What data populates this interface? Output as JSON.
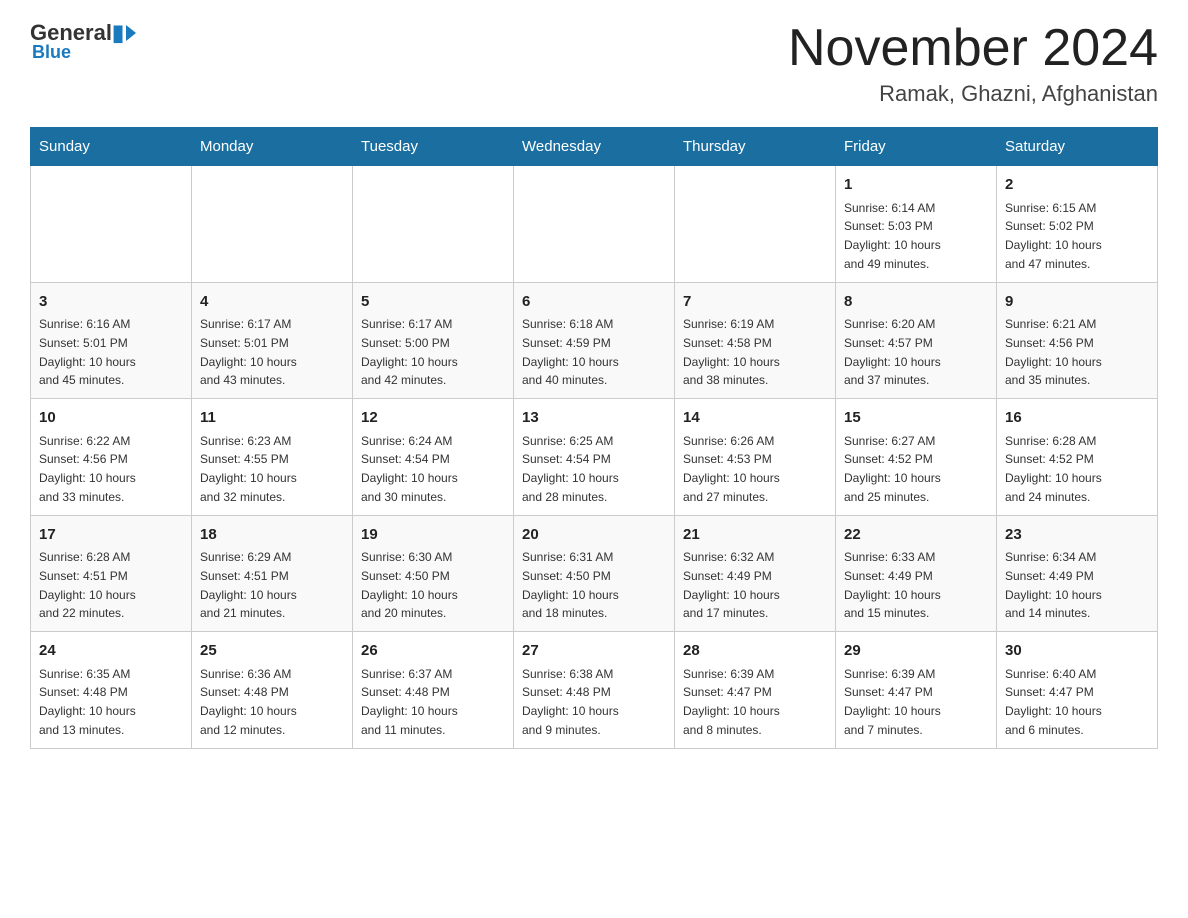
{
  "logo": {
    "general": "General",
    "blue": "Blue"
  },
  "header": {
    "month": "November 2024",
    "location": "Ramak, Ghazni, Afghanistan"
  },
  "weekdays": [
    "Sunday",
    "Monday",
    "Tuesday",
    "Wednesday",
    "Thursday",
    "Friday",
    "Saturday"
  ],
  "weeks": [
    [
      {
        "day": "",
        "info": ""
      },
      {
        "day": "",
        "info": ""
      },
      {
        "day": "",
        "info": ""
      },
      {
        "day": "",
        "info": ""
      },
      {
        "day": "",
        "info": ""
      },
      {
        "day": "1",
        "info": "Sunrise: 6:14 AM\nSunset: 5:03 PM\nDaylight: 10 hours\nand 49 minutes."
      },
      {
        "day": "2",
        "info": "Sunrise: 6:15 AM\nSunset: 5:02 PM\nDaylight: 10 hours\nand 47 minutes."
      }
    ],
    [
      {
        "day": "3",
        "info": "Sunrise: 6:16 AM\nSunset: 5:01 PM\nDaylight: 10 hours\nand 45 minutes."
      },
      {
        "day": "4",
        "info": "Sunrise: 6:17 AM\nSunset: 5:01 PM\nDaylight: 10 hours\nand 43 minutes."
      },
      {
        "day": "5",
        "info": "Sunrise: 6:17 AM\nSunset: 5:00 PM\nDaylight: 10 hours\nand 42 minutes."
      },
      {
        "day": "6",
        "info": "Sunrise: 6:18 AM\nSunset: 4:59 PM\nDaylight: 10 hours\nand 40 minutes."
      },
      {
        "day": "7",
        "info": "Sunrise: 6:19 AM\nSunset: 4:58 PM\nDaylight: 10 hours\nand 38 minutes."
      },
      {
        "day": "8",
        "info": "Sunrise: 6:20 AM\nSunset: 4:57 PM\nDaylight: 10 hours\nand 37 minutes."
      },
      {
        "day": "9",
        "info": "Sunrise: 6:21 AM\nSunset: 4:56 PM\nDaylight: 10 hours\nand 35 minutes."
      }
    ],
    [
      {
        "day": "10",
        "info": "Sunrise: 6:22 AM\nSunset: 4:56 PM\nDaylight: 10 hours\nand 33 minutes."
      },
      {
        "day": "11",
        "info": "Sunrise: 6:23 AM\nSunset: 4:55 PM\nDaylight: 10 hours\nand 32 minutes."
      },
      {
        "day": "12",
        "info": "Sunrise: 6:24 AM\nSunset: 4:54 PM\nDaylight: 10 hours\nand 30 minutes."
      },
      {
        "day": "13",
        "info": "Sunrise: 6:25 AM\nSunset: 4:54 PM\nDaylight: 10 hours\nand 28 minutes."
      },
      {
        "day": "14",
        "info": "Sunrise: 6:26 AM\nSunset: 4:53 PM\nDaylight: 10 hours\nand 27 minutes."
      },
      {
        "day": "15",
        "info": "Sunrise: 6:27 AM\nSunset: 4:52 PM\nDaylight: 10 hours\nand 25 minutes."
      },
      {
        "day": "16",
        "info": "Sunrise: 6:28 AM\nSunset: 4:52 PM\nDaylight: 10 hours\nand 24 minutes."
      }
    ],
    [
      {
        "day": "17",
        "info": "Sunrise: 6:28 AM\nSunset: 4:51 PM\nDaylight: 10 hours\nand 22 minutes."
      },
      {
        "day": "18",
        "info": "Sunrise: 6:29 AM\nSunset: 4:51 PM\nDaylight: 10 hours\nand 21 minutes."
      },
      {
        "day": "19",
        "info": "Sunrise: 6:30 AM\nSunset: 4:50 PM\nDaylight: 10 hours\nand 20 minutes."
      },
      {
        "day": "20",
        "info": "Sunrise: 6:31 AM\nSunset: 4:50 PM\nDaylight: 10 hours\nand 18 minutes."
      },
      {
        "day": "21",
        "info": "Sunrise: 6:32 AM\nSunset: 4:49 PM\nDaylight: 10 hours\nand 17 minutes."
      },
      {
        "day": "22",
        "info": "Sunrise: 6:33 AM\nSunset: 4:49 PM\nDaylight: 10 hours\nand 15 minutes."
      },
      {
        "day": "23",
        "info": "Sunrise: 6:34 AM\nSunset: 4:49 PM\nDaylight: 10 hours\nand 14 minutes."
      }
    ],
    [
      {
        "day": "24",
        "info": "Sunrise: 6:35 AM\nSunset: 4:48 PM\nDaylight: 10 hours\nand 13 minutes."
      },
      {
        "day": "25",
        "info": "Sunrise: 6:36 AM\nSunset: 4:48 PM\nDaylight: 10 hours\nand 12 minutes."
      },
      {
        "day": "26",
        "info": "Sunrise: 6:37 AM\nSunset: 4:48 PM\nDaylight: 10 hours\nand 11 minutes."
      },
      {
        "day": "27",
        "info": "Sunrise: 6:38 AM\nSunset: 4:48 PM\nDaylight: 10 hours\nand 9 minutes."
      },
      {
        "day": "28",
        "info": "Sunrise: 6:39 AM\nSunset: 4:47 PM\nDaylight: 10 hours\nand 8 minutes."
      },
      {
        "day": "29",
        "info": "Sunrise: 6:39 AM\nSunset: 4:47 PM\nDaylight: 10 hours\nand 7 minutes."
      },
      {
        "day": "30",
        "info": "Sunrise: 6:40 AM\nSunset: 4:47 PM\nDaylight: 10 hours\nand 6 minutes."
      }
    ]
  ]
}
